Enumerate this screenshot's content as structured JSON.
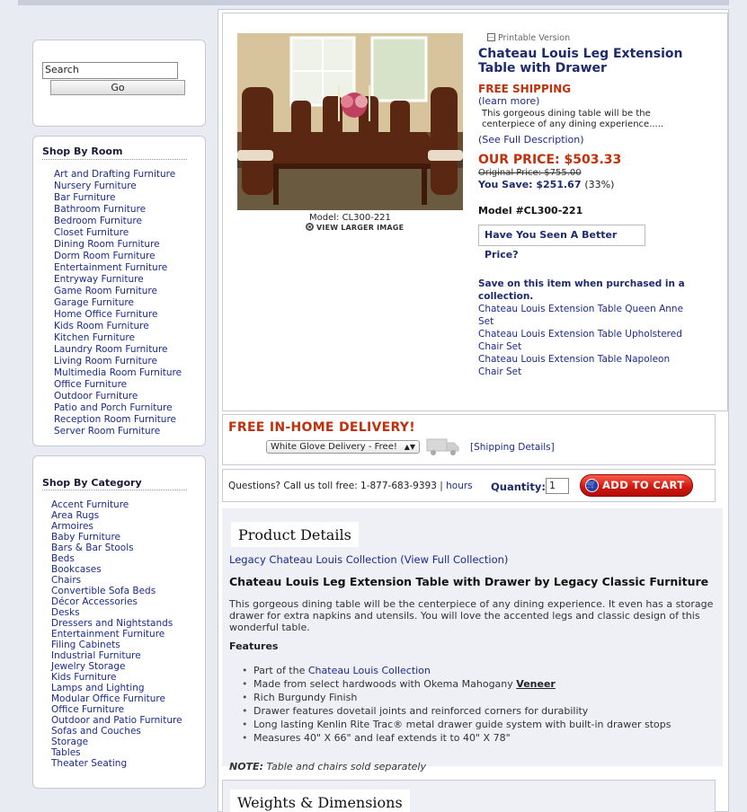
{
  "search": {
    "input_value": "Search",
    "go_label": "Go"
  },
  "shop_by_room": {
    "title": "Shop By Room",
    "items": [
      "Art and Drafting Furniture",
      "Nursery Furniture",
      "Bar Furniture",
      "Bathroom Furniture",
      "Bedroom Furniture",
      "Closet Furniture",
      "Dining Room Furniture",
      "Dorm Room Furniture",
      "Entertainment Furniture",
      "Entryway Furniture",
      "Game Room Furniture",
      "Garage Furniture",
      "Home Office Furniture",
      "Kids Room Furniture",
      "Kitchen Furniture",
      "Laundry Room Furniture",
      "Living Room Furniture",
      "Multimedia Room Furniture",
      "Office Furniture",
      "Outdoor Furniture",
      "Patio and Porch Furniture",
      "Reception Room Furniture",
      "Server Room Furniture"
    ]
  },
  "shop_by_category": {
    "title": "Shop By Category",
    "items": [
      "Accent Furniture",
      "Area Rugs",
      "Armoires",
      "Baby Furniture",
      "Bars & Bar Stools",
      "Beds",
      "Bookcases",
      "Chairs",
      "Convertible Sofa Beds",
      "Décor Accessories",
      "Desks",
      "Dressers and Nightstands",
      "Entertainment Furniture",
      "Filing Cabinets",
      "Industrial Furniture",
      "Jewelry Storage",
      "Kids Furniture",
      "Lamps and Lighting",
      "Modular Office Furniture",
      "Office Furniture",
      "Outdoor and Patio Furniture",
      "Sofas and Couches",
      "Storage",
      "Tables",
      "Theater Seating"
    ]
  },
  "product": {
    "printable": "Printable Version",
    "title": "Chateau Louis Leg Extension Table with Drawer",
    "free_shipping": "FREE SHIPPING",
    "learn_more": "(learn more)",
    "short_desc": "This gorgeous dining table will be the centerpiece of any dining experience.....",
    "see_full": "(See Full Description)",
    "our_price": "OUR PRICE: $503.33",
    "original_price": "Original Price: $755.00",
    "you_save_label": "You Save: $251.67",
    "you_save_pct": "(33%)",
    "model": "Model #CL300-221",
    "image_caption": "Model:  CL300-221",
    "view_larger": "VIEW LARGER IMAGE",
    "better_price": "Have You Seen A Better Price?",
    "save_heading": "Save on this item when purchased in a collection.",
    "collections": [
      "Chateau Louis Extension Table Queen Anne Set",
      "Chateau Louis Extension Table Upholstered Chair Set",
      "Chateau Louis Extension Table Napoleon Chair Set"
    ]
  },
  "delivery": {
    "title": "FREE IN-HOME DELIVERY!",
    "selected_option": "White Glove Delivery - Free!",
    "shipping_details": "[Shipping Details]"
  },
  "cart": {
    "questions": "Questions? Call us toll free:  1-877-683-9393  |",
    "hours": "hours",
    "quantity_label": "Quantity:",
    "quantity_value": "1",
    "add_to_cart": "ADD TO CART"
  },
  "details": {
    "tab_label": "Product Details",
    "collection_prefix": "Legacy Chateau Louis Collection ",
    "collection_link": "(View Full Collection)",
    "full_title": "Chateau Louis Leg Extension Table with Drawer by Legacy Classic Furniture",
    "long_desc": "This gorgeous dining table will be the centerpiece of any dining experience. It even has a storage drawer for extra napkins and utensils. You will love the accented legs and classic design of this wonderful table.",
    "features_heading": "Features",
    "feature_1_prefix": "Part of the ",
    "feature_1_link": "Chateau Louis Collection",
    "feature_2_prefix": "Made from select hardwoods with Okema Mahogany ",
    "feature_2_bold": "Veneer",
    "features_rest": [
      "Rich Burgundy Finish",
      "Drawer features dovetail joints and reinforced corners for durability",
      "Long lasting Kenlin Rite Trac® metal drawer guide system with built-in drawer stops",
      "Measures 40\" X 66\" and leaf extends it to 40\" X 78\""
    ],
    "note_label": "NOTE:",
    "note_text": " Table and chairs sold separately"
  },
  "weights": {
    "tab_label": "Weights & Dimensions"
  },
  "colors": {
    "accent_red": "#c1300b",
    "navy": "#1d2b6e",
    "link_blue": "#1a2a8c",
    "page_bg": "#e9ebf3"
  }
}
